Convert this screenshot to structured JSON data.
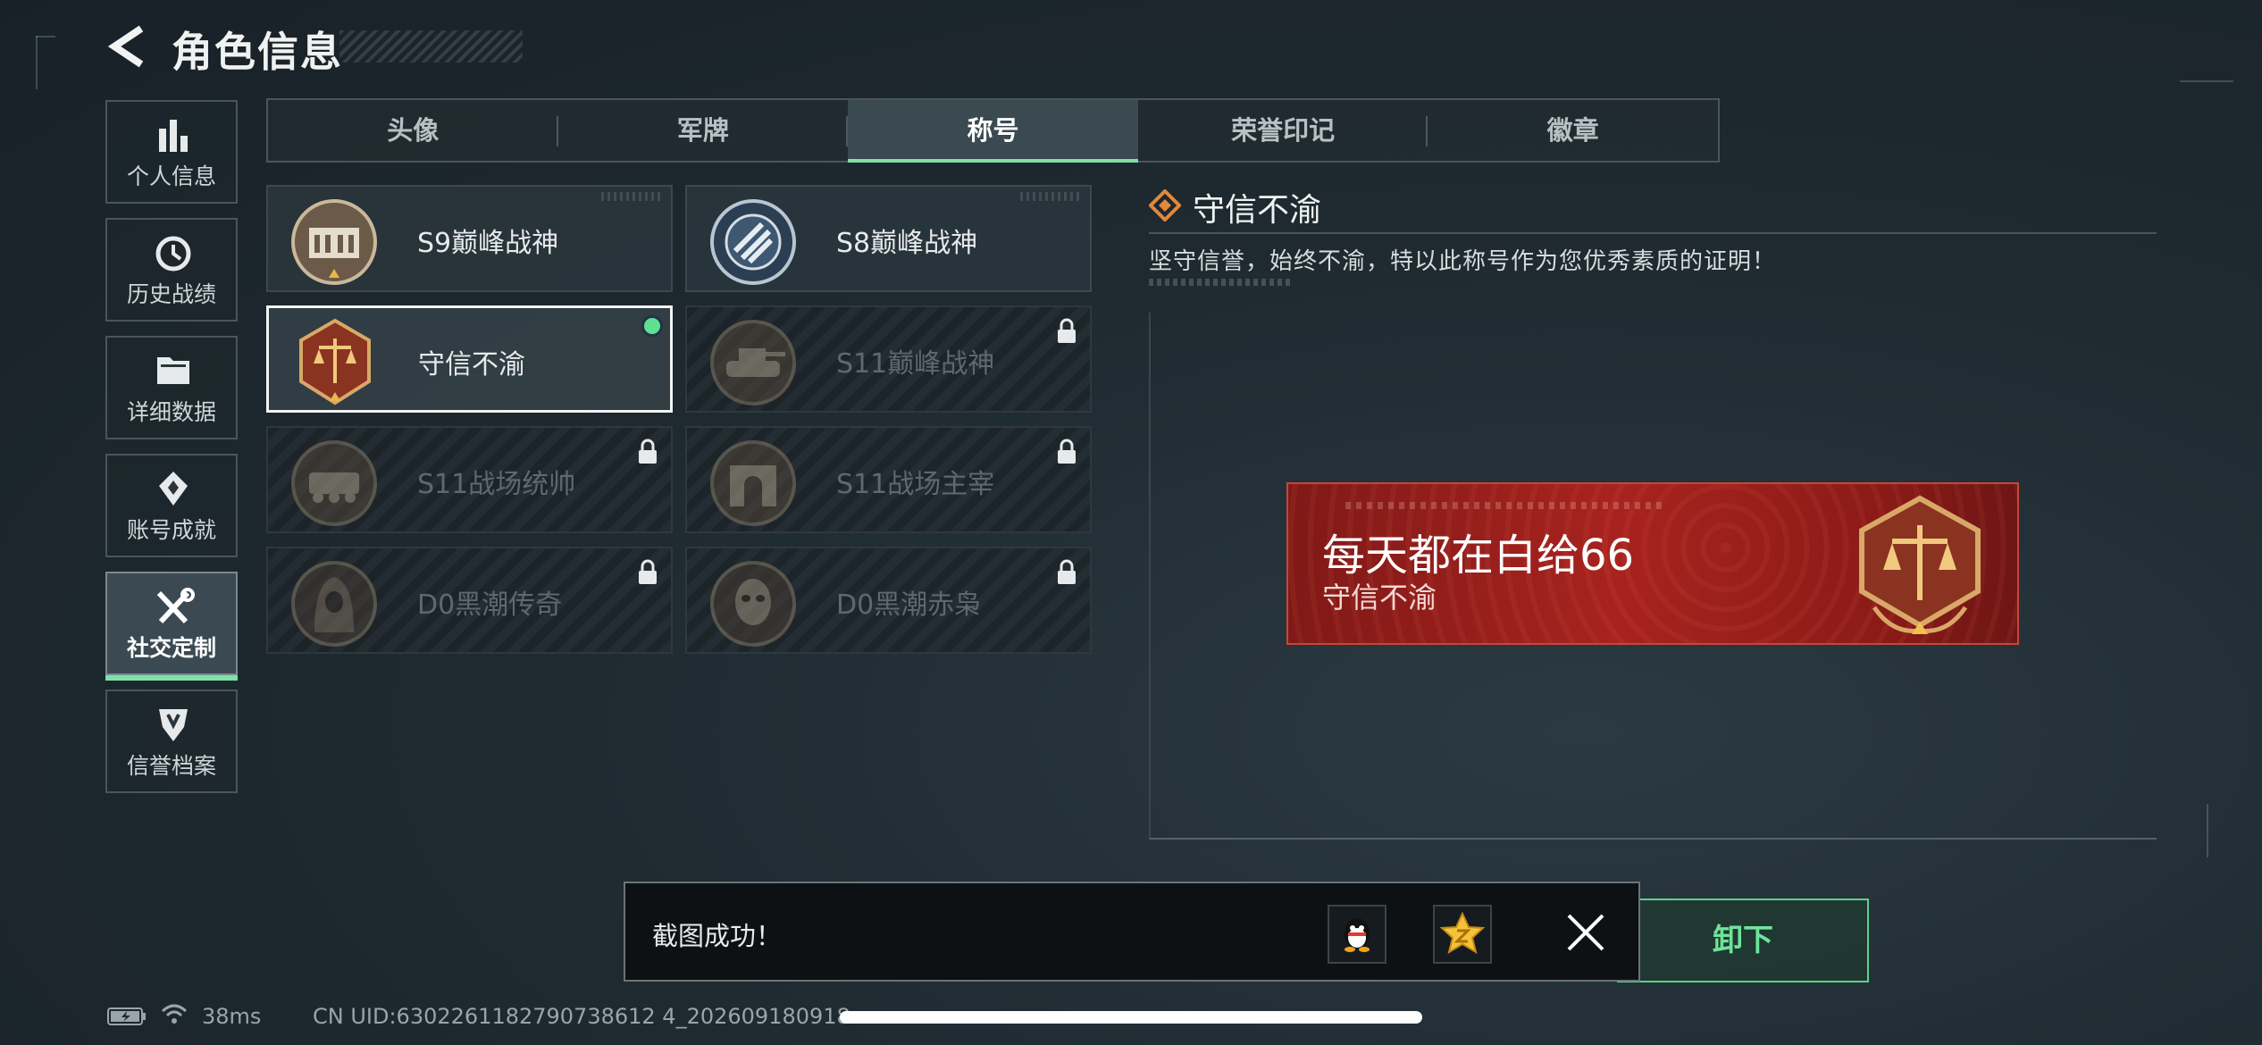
{
  "header": {
    "title": "角色信息",
    "back_icon": "back-arrow-icon"
  },
  "nav": [
    {
      "label": "个人信息",
      "icon": "bar-chart-icon",
      "active": false
    },
    {
      "label": "历史战绩",
      "icon": "clock-icon",
      "active": false
    },
    {
      "label": "详细数据",
      "icon": "folder-icon",
      "active": false
    },
    {
      "label": "账号成就",
      "icon": "achievement-icon",
      "active": false
    },
    {
      "label": "社交定制",
      "icon": "tools-icon",
      "active": true
    },
    {
      "label": "信誉档案",
      "icon": "shield-icon",
      "active": false
    }
  ],
  "tabs": [
    {
      "label": "头像",
      "active": false
    },
    {
      "label": "军牌",
      "active": false
    },
    {
      "label": "称号",
      "active": true
    },
    {
      "label": "荣誉印记",
      "active": false
    },
    {
      "label": "徽章",
      "active": false
    }
  ],
  "titles": [
    {
      "name": "S9巅峰战神",
      "locked": false,
      "selected": false
    },
    {
      "name": "S8巅峰战神",
      "locked": false,
      "selected": false
    },
    {
      "name": "守信不渝",
      "locked": false,
      "selected": true
    },
    {
      "name": "S11巅峰战神",
      "locked": true,
      "selected": false
    },
    {
      "name": "S11战场统帅",
      "locked": true,
      "selected": false
    },
    {
      "name": "S11战场主宰",
      "locked": true,
      "selected": false
    },
    {
      "name": "D0黑潮传奇",
      "locked": true,
      "selected": false
    },
    {
      "name": "D0黑潮赤枭",
      "locked": true,
      "selected": false
    }
  ],
  "detail": {
    "title": "守信不渝",
    "description": "坚守信誉，始终不渝，特以此称号作为您优秀素质的证明！"
  },
  "banner": {
    "player_name": "每天都在白给66",
    "title": "守信不渝"
  },
  "unequip_label": "卸下",
  "toast": {
    "message": "截图成功！",
    "share_icons": [
      "qq-icon",
      "qzone-icon"
    ],
    "close_icon": "close-icon"
  },
  "status": {
    "ping": "38ms",
    "uid": "CN UID:6302261182790738612 4_202609180918"
  },
  "colors": {
    "accent": "#7fe0a8",
    "banner": "#a8231f",
    "selected_dot": "#5fe08f"
  }
}
